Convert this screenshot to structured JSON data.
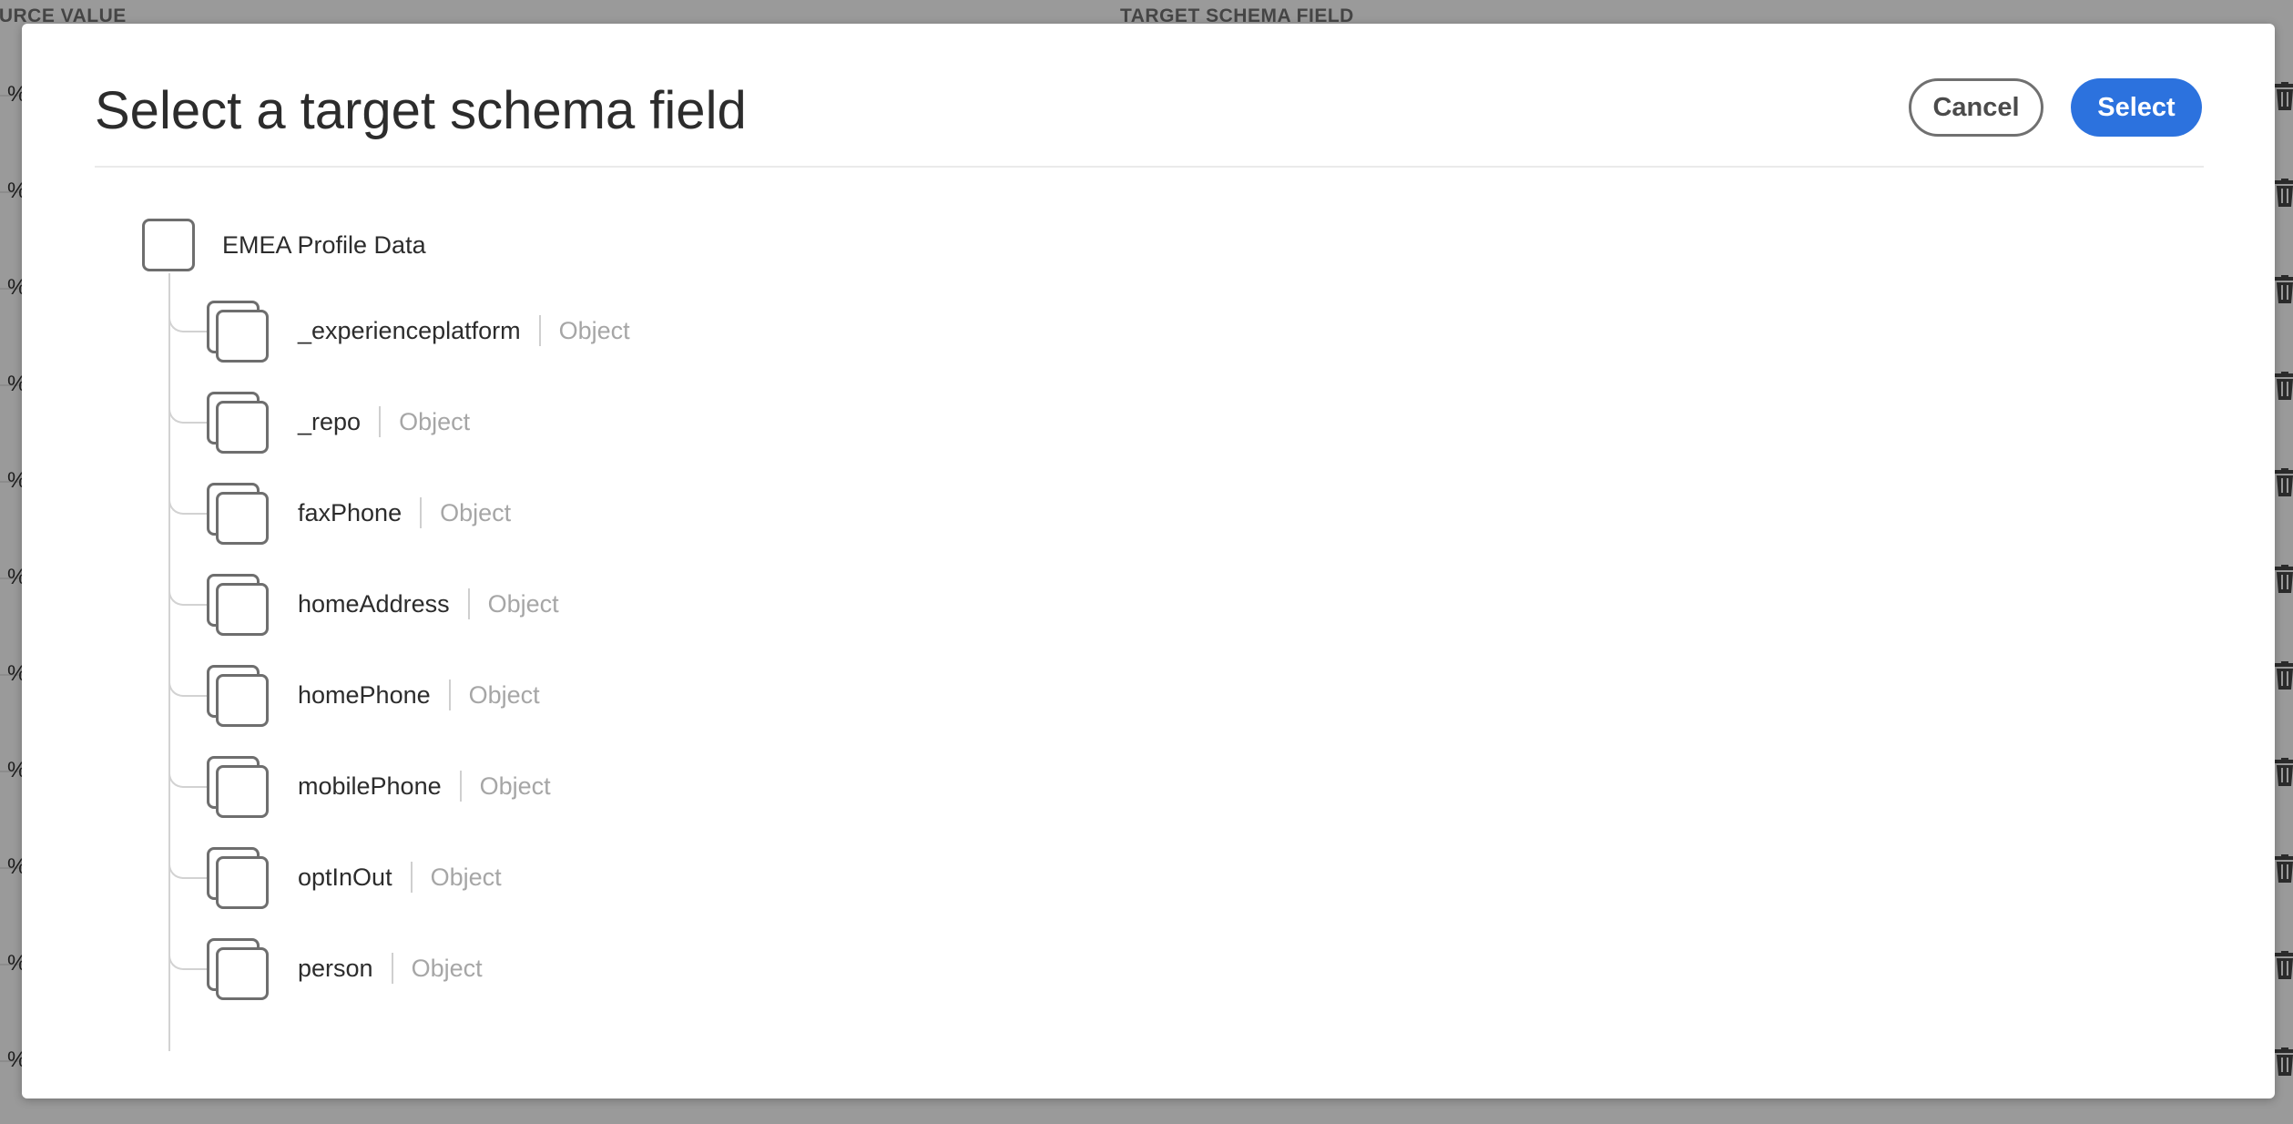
{
  "background": {
    "source_header": "OURCE VALUE",
    "target_header": "TARGET SCHEMA FIELD",
    "left_glyph": "%"
  },
  "modal": {
    "title": "Select a target schema field",
    "cancel_label": "Cancel",
    "select_label": "Select"
  },
  "tree": {
    "root": {
      "label": "EMEA Profile Data"
    },
    "children": [
      {
        "name": "_experienceplatform",
        "type": "Object"
      },
      {
        "name": "_repo",
        "type": "Object"
      },
      {
        "name": "faxPhone",
        "type": "Object"
      },
      {
        "name": "homeAddress",
        "type": "Object"
      },
      {
        "name": "homePhone",
        "type": "Object"
      },
      {
        "name": "mobilePhone",
        "type": "Object"
      },
      {
        "name": "optInOut",
        "type": "Object"
      },
      {
        "name": "person",
        "type": "Object"
      }
    ]
  },
  "colors": {
    "accent": "#2c72de",
    "overlay": "#9a9a9a",
    "type_text": "#a6a6a6"
  }
}
